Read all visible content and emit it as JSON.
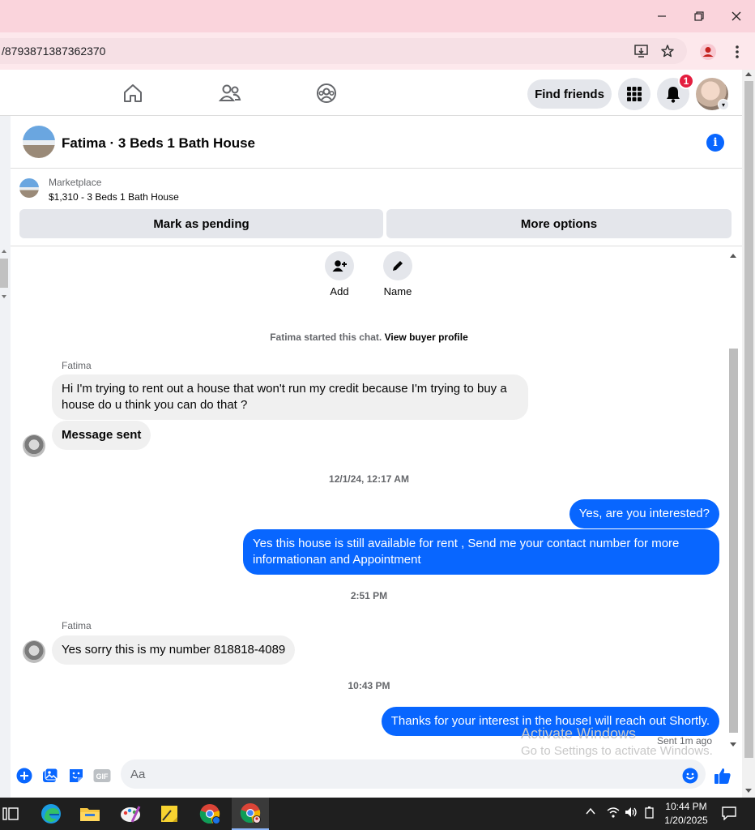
{
  "browser": {
    "url": "/8793871387362370",
    "window_controls": [
      "minimize",
      "restore",
      "close"
    ]
  },
  "facebook_nav": {
    "find_friends_label": "Find friends",
    "notification_count": "1"
  },
  "chat": {
    "title": "Fatima · 3 Beds 1 Bath House",
    "marketplace_label": "Marketplace",
    "listing": "$1,310 - 3 Beds 1 Bath House",
    "mark_pending_label": "Mark as pending",
    "more_options_label": "More options",
    "quick_actions": [
      {
        "label": "Add",
        "icon": "add-person-icon"
      },
      {
        "label": "Name",
        "icon": "pencil-icon"
      }
    ],
    "started_text": "Fatima started this chat.",
    "view_buyer_label": "View buyer profile",
    "messages": [
      {
        "sender": "Fatima",
        "text": "Hi I'm trying to rent out a house that won't run my credit because I'm trying to buy a house do u think you can do that ?"
      },
      {
        "text": "Message sent"
      },
      {
        "timestamp": "12/1/24, 12:17 AM"
      },
      {
        "text": "Yes, are you interested?"
      },
      {
        "text": "Yes this house is still available for rent , Send me your contact number for more informationan and Appointment"
      },
      {
        "timestamp": "2:51 PM"
      },
      {
        "sender": "Fatima",
        "text": "Yes sorry this is my number 818818-4089"
      },
      {
        "timestamp": "10:43 PM"
      },
      {
        "text": "Thanks for your interest in the houseI will reach out Shortly."
      }
    ],
    "sent_status": "Sent 1m ago",
    "input_placeholder": "Aa",
    "gif_label": "GIF"
  },
  "watermark": {
    "line1": "Activate Windows",
    "line2": "Go to Settings to activate Windows."
  },
  "taskbar": {
    "time": "10:44 PM",
    "date": "1/20/2025"
  },
  "colors": {
    "messenger_blue": "#0866ff",
    "title_bar_pink": "#fad4dc",
    "notification_red": "#e41e3f"
  }
}
